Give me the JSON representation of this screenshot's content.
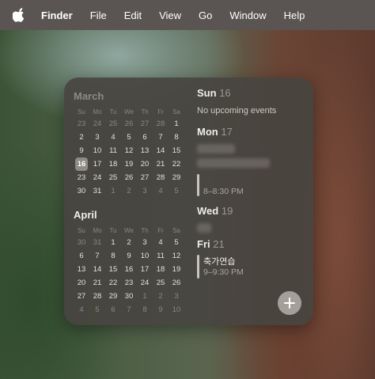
{
  "menubar": {
    "app": "Finder",
    "items": [
      "File",
      "Edit",
      "View",
      "Go",
      "Window",
      "Help"
    ]
  },
  "calendar": {
    "weekdays": [
      "Su",
      "Mo",
      "Tu",
      "We",
      "Th",
      "Fr",
      "Sa"
    ],
    "months": [
      {
        "name": "March",
        "weeks": [
          [
            "23",
            "24",
            "25",
            "26",
            "27",
            "28",
            "1"
          ],
          [
            "2",
            "3",
            "4",
            "5",
            "6",
            "7",
            "8"
          ],
          [
            "9",
            "10",
            "11",
            "12",
            "13",
            "14",
            "15"
          ],
          [
            "16",
            "17",
            "18",
            "19",
            "20",
            "21",
            "22"
          ],
          [
            "23",
            "24",
            "25",
            "26",
            "27",
            "28",
            "29"
          ],
          [
            "30",
            "31",
            "1",
            "2",
            "3",
            "4",
            "5"
          ]
        ],
        "other_month": [
          [
            0,
            0
          ],
          [
            0,
            1
          ],
          [
            0,
            2
          ],
          [
            0,
            3
          ],
          [
            0,
            4
          ],
          [
            0,
            5
          ],
          [
            5,
            2
          ],
          [
            5,
            3
          ],
          [
            5,
            4
          ],
          [
            5,
            5
          ],
          [
            5,
            6
          ]
        ],
        "today": [
          3,
          0
        ]
      },
      {
        "name": "April",
        "weeks": [
          [
            "30",
            "31",
            "1",
            "2",
            "3",
            "4",
            "5"
          ],
          [
            "6",
            "7",
            "8",
            "9",
            "10",
            "11",
            "12"
          ],
          [
            "13",
            "14",
            "15",
            "16",
            "17",
            "18",
            "19"
          ],
          [
            "20",
            "21",
            "22",
            "23",
            "24",
            "25",
            "26"
          ],
          [
            "27",
            "28",
            "29",
            "30",
            "1",
            "2",
            "3"
          ],
          [
            "4",
            "5",
            "6",
            "7",
            "8",
            "9",
            "10"
          ]
        ],
        "other_month": [
          [
            0,
            0
          ],
          [
            0,
            1
          ],
          [
            4,
            4
          ],
          [
            4,
            5
          ],
          [
            4,
            6
          ],
          [
            5,
            0
          ],
          [
            5,
            1
          ],
          [
            5,
            2
          ],
          [
            5,
            3
          ],
          [
            5,
            4
          ],
          [
            5,
            5
          ],
          [
            5,
            6
          ]
        ],
        "today": null
      }
    ]
  },
  "events": {
    "sun": {
      "day": "Sun",
      "num": "16",
      "note": "No upcoming events"
    },
    "mon": {
      "day": "Mon",
      "num": "17",
      "time": "8–8:30 PM"
    },
    "wed": {
      "day": "Wed",
      "num": "19"
    },
    "fri": {
      "day": "Fri",
      "num": "21",
      "title": "축가연습",
      "time": "9–9:30 PM"
    }
  },
  "add_button": {
    "icon": "plus-icon"
  }
}
